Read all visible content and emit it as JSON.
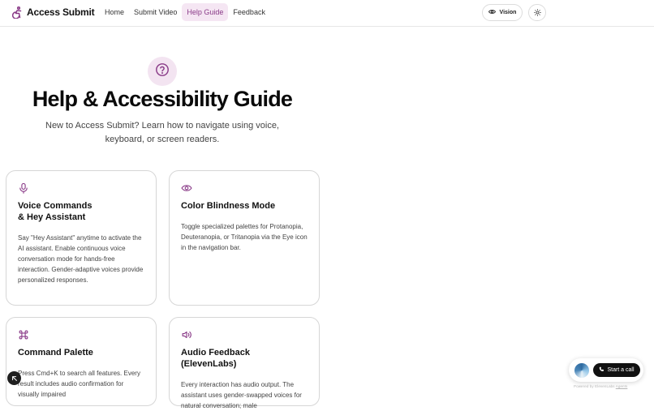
{
  "brand": {
    "name": "Access Submit"
  },
  "nav": {
    "links": [
      "Home",
      "Submit Video",
      "Help Guide",
      "Feedback"
    ],
    "active": "Help Guide",
    "vision_label": "Vision"
  },
  "hero": {
    "title": "Help & Accessibility Guide",
    "subtitle": "New to Access Submit? Learn how to navigate using voice, keyboard, or screen readers."
  },
  "cards": [
    {
      "icon": "microphone-icon",
      "title": "Voice Commands\n& Hey Assistant",
      "body": "Say \"Hey Assistant\" anytime to activate the AI assistant. Enable continuous voice conversation mode for hands-free interaction. Gender-adaptive voices provide personalized responses."
    },
    {
      "icon": "eye-icon",
      "title": "Color Blindness Mode",
      "body": "Toggle specialized palettes for Protanopia, Deuteranopia, or Tritanopia via the Eye icon in the navigation bar."
    },
    {
      "icon": "command-icon",
      "title": "Command Palette",
      "body": "Press Cmd+K to search all features. Every result includes audio confirmation for visually impaired"
    },
    {
      "icon": "speaker-icon",
      "title": "Audio Feedback (ElevenLabs)",
      "body": "Every interaction has audio output. The assistant uses gender-swapped voices for natural conversation; male"
    }
  ],
  "widget": {
    "call_label": "Start a call",
    "powered_prefix": "Powered by ElevenLabs",
    "powered_link": "Agents"
  },
  "colors": {
    "accent": "#8a3b88",
    "accent_bg": "#f3e4f1",
    "border": "#d6d6d6"
  }
}
